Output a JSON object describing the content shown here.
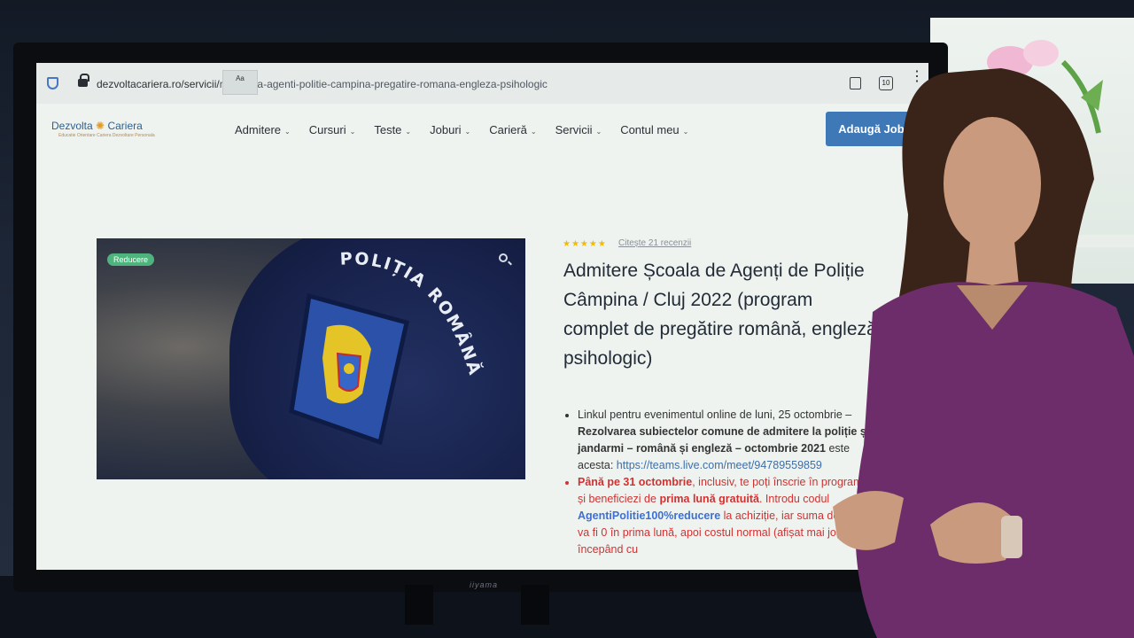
{
  "browser": {
    "url_domain": "dezvoltacariera.ro/servicii/",
    "url_path": "re-scoala-agenti-politie-campina-pregatire-romana-engleza-psihologic",
    "tooltip": "Aa",
    "tab_count": "10"
  },
  "site": {
    "logo_left": "Dezvolta",
    "logo_right": "Cariera",
    "logo_tagline": "Educatie Orientare Cariera Dezvoltare Personala"
  },
  "nav": {
    "items": [
      {
        "label": "Admitere"
      },
      {
        "label": "Cursuri"
      },
      {
        "label": "Teste"
      },
      {
        "label": "Joburi"
      },
      {
        "label": "Carieră"
      },
      {
        "label": "Servicii"
      },
      {
        "label": "Contul meu"
      }
    ],
    "cta": "Adaugă Job"
  },
  "product": {
    "badge": "Reducere",
    "patch_text": "POLIȚIA ROMÂNĂ",
    "stars": "★★★★★",
    "reviews_link": "Citește 21 recenzii",
    "title": "Admitere Școala de Agenți de Poliție Câmpina / Cluj 2022 (program complet de pregătire română, engleză, psihologic)",
    "bullet1_a": "Linkul pentru evenimentul online de luni, 25 octombrie –",
    "bullet1_b": "Rezolvarea subiectelor comune de admitere la poliție și jandarmi – română și engleză – octombrie 2021",
    "bullet1_c": "este acesta:",
    "bullet1_link": "https://teams.live.com/meet/94789559859",
    "bullet2_a": "Până pe 31 octombrie",
    "bullet2_b": ", inclusiv, te poți înscrie în program și beneficiezi de",
    "bullet2_c": "prima lună gratuită",
    "bullet2_d": ". Introdu codul",
    "bullet2_code": "AgentiPolitie100%reducere",
    "bullet2_e": "la achiziție, iar suma de plată va fi 0 în prima lună, apoi costul normal (afișat mai jos) începând cu"
  },
  "hardware": {
    "monitor_brand": "iiyama"
  }
}
